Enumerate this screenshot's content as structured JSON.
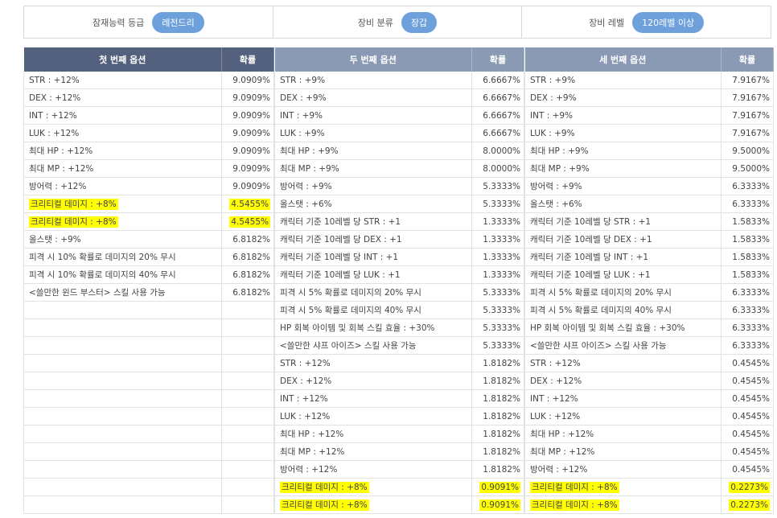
{
  "filters": {
    "grade_label": "잠재능력 등급",
    "grade_value": "레전드리",
    "category_label": "장비 분류",
    "category_value": "장갑",
    "level_label": "장비 레벨",
    "level_value": "120레벨 이상"
  },
  "first": {
    "header": "첫 번째 옵션",
    "prob_header": "확률",
    "rows": [
      {
        "o": "STR : +12%",
        "p": "9.0909%"
      },
      {
        "o": "DEX : +12%",
        "p": "9.0909%"
      },
      {
        "o": "INT : +12%",
        "p": "9.0909%"
      },
      {
        "o": "LUK : +12%",
        "p": "9.0909%"
      },
      {
        "o": "최대 HP : +12%",
        "p": "9.0909%"
      },
      {
        "o": "최대 MP : +12%",
        "p": "9.0909%"
      },
      {
        "o": "방어력 : +12%",
        "p": "9.0909%"
      },
      {
        "o": "크리티컬 데미지 : +8%",
        "p": "4.5455%",
        "h": true
      },
      {
        "o": "크리티컬 데미지 : +8%",
        "p": "4.5455%",
        "h": true
      },
      {
        "o": "올스탯 : +9%",
        "p": "6.8182%"
      },
      {
        "o": "피격 시 10% 확률로 데미지의 20% 무시",
        "p": "6.8182%"
      },
      {
        "o": "피격 시 10% 확률로 데미지의 40% 무시",
        "p": "6.8182%"
      },
      {
        "o": "<쓸만한 윈드 부스터> 스킬 사용 가능",
        "p": "6.8182%"
      },
      {
        "o": "",
        "p": ""
      },
      {
        "o": "",
        "p": ""
      },
      {
        "o": "",
        "p": ""
      },
      {
        "o": "",
        "p": ""
      },
      {
        "o": "",
        "p": ""
      },
      {
        "o": "",
        "p": ""
      },
      {
        "o": "",
        "p": ""
      },
      {
        "o": "",
        "p": ""
      },
      {
        "o": "",
        "p": ""
      },
      {
        "o": "",
        "p": ""
      },
      {
        "o": "",
        "p": ""
      },
      {
        "o": "",
        "p": ""
      }
    ]
  },
  "second": {
    "header": "두 번째 옵션",
    "prob_header": "확률",
    "rows": [
      {
        "o": "STR : +9%",
        "p": "6.6667%"
      },
      {
        "o": "DEX : +9%",
        "p": "6.6667%"
      },
      {
        "o": "INT : +9%",
        "p": "6.6667%"
      },
      {
        "o": "LUK : +9%",
        "p": "6.6667%"
      },
      {
        "o": "최대 HP : +9%",
        "p": "8.0000%"
      },
      {
        "o": "최대 MP : +9%",
        "p": "8.0000%"
      },
      {
        "o": "방어력 : +9%",
        "p": "5.3333%"
      },
      {
        "o": "올스탯 : +6%",
        "p": "5.3333%"
      },
      {
        "o": "캐릭터 기준 10레벨 당 STR : +1",
        "p": "1.3333%"
      },
      {
        "o": "캐릭터 기준 10레벨 당 DEX : +1",
        "p": "1.3333%"
      },
      {
        "o": "캐릭터 기준 10레벨 당 INT : +1",
        "p": "1.3333%"
      },
      {
        "o": "캐릭터 기준 10레벨 당 LUK : +1",
        "p": "1.3333%"
      },
      {
        "o": "피격 시 5% 확률로 데미지의 20% 무시",
        "p": "5.3333%"
      },
      {
        "o": "피격 시 5% 확률로 데미지의 40% 무시",
        "p": "5.3333%"
      },
      {
        "o": "HP 회복 아이템 및 회복 스킬 효율 : +30%",
        "p": "5.3333%"
      },
      {
        "o": "<쓸만한 샤프 아이즈> 스킬 사용 가능",
        "p": "5.3333%"
      },
      {
        "o": "STR : +12%",
        "p": "1.8182%"
      },
      {
        "o": "DEX : +12%",
        "p": "1.8182%"
      },
      {
        "o": "INT : +12%",
        "p": "1.8182%"
      },
      {
        "o": "LUK : +12%",
        "p": "1.8182%"
      },
      {
        "o": "최대 HP : +12%",
        "p": "1.8182%"
      },
      {
        "o": "최대 MP : +12%",
        "p": "1.8182%"
      },
      {
        "o": "방어력 : +12%",
        "p": "1.8182%"
      },
      {
        "o": "크리티컬 데미지 : +8%",
        "p": "0.9091%",
        "h": true
      },
      {
        "o": "크리티컬 데미지 : +8%",
        "p": "0.9091%",
        "h": true
      }
    ]
  },
  "third": {
    "header": "세 번째 옵션",
    "prob_header": "확률",
    "rows": [
      {
        "o": "STR : +9%",
        "p": "7.9167%"
      },
      {
        "o": "DEX : +9%",
        "p": "7.9167%"
      },
      {
        "o": "INT : +9%",
        "p": "7.9167%"
      },
      {
        "o": "LUK : +9%",
        "p": "7.9167%"
      },
      {
        "o": "최대 HP : +9%",
        "p": "9.5000%"
      },
      {
        "o": "최대 MP : +9%",
        "p": "9.5000%"
      },
      {
        "o": "방어력 : +9%",
        "p": "6.3333%"
      },
      {
        "o": "올스탯 : +6%",
        "p": "6.3333%"
      },
      {
        "o": "캐릭터 기준 10레벨 당 STR : +1",
        "p": "1.5833%"
      },
      {
        "o": "캐릭터 기준 10레벨 당 DEX : +1",
        "p": "1.5833%"
      },
      {
        "o": "캐릭터 기준 10레벨 당 INT : +1",
        "p": "1.5833%"
      },
      {
        "o": "캐릭터 기준 10레벨 당 LUK : +1",
        "p": "1.5833%"
      },
      {
        "o": "피격 시 5% 확률로 데미지의 20% 무시",
        "p": "6.3333%"
      },
      {
        "o": "피격 시 5% 확률로 데미지의 40% 무시",
        "p": "6.3333%"
      },
      {
        "o": "HP 회복 아이템 및 회복 스킬 효율 : +30%",
        "p": "6.3333%"
      },
      {
        "o": "<쓸만한 샤프 아이즈> 스킬 사용 가능",
        "p": "6.3333%"
      },
      {
        "o": "STR : +12%",
        "p": "0.4545%"
      },
      {
        "o": "DEX : +12%",
        "p": "0.4545%"
      },
      {
        "o": "INT : +12%",
        "p": "0.4545%"
      },
      {
        "o": "LUK : +12%",
        "p": "0.4545%"
      },
      {
        "o": "최대 HP : +12%",
        "p": "0.4545%"
      },
      {
        "o": "최대 MP : +12%",
        "p": "0.4545%"
      },
      {
        "o": "방어력 : +12%",
        "p": "0.4545%"
      },
      {
        "o": "크리티컬 데미지 : +8%",
        "p": "0.2273%",
        "h": true
      },
      {
        "o": "크리티컬 데미지 : +8%",
        "p": "0.2273%",
        "h": true
      }
    ]
  }
}
